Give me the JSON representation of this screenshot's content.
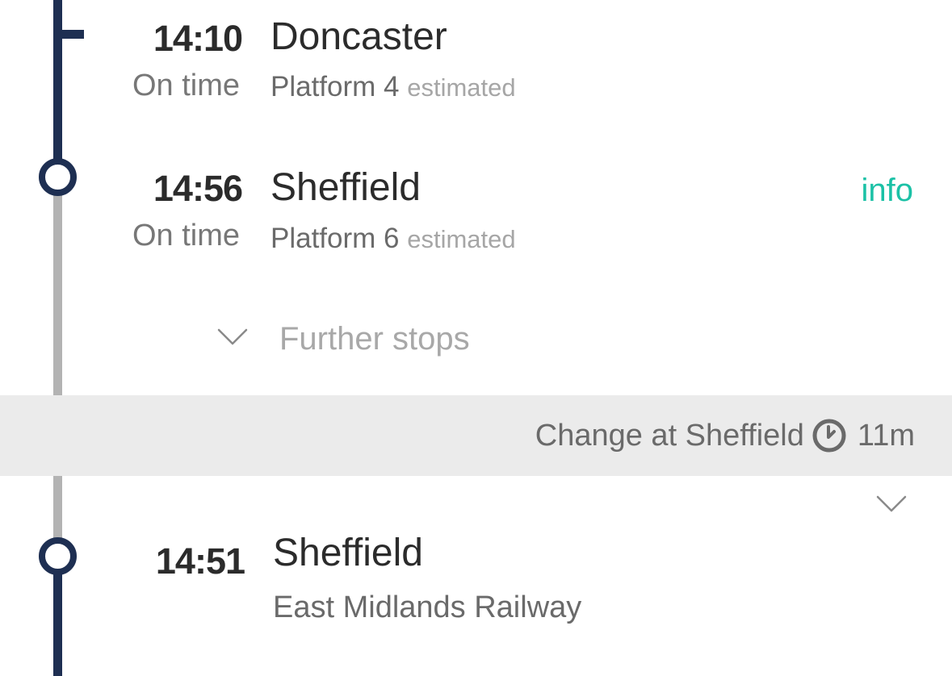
{
  "stops": [
    {
      "time": "14:10",
      "status": "On time",
      "station": "Doncaster",
      "platform": "Platform 4",
      "platform_note": "estimated"
    },
    {
      "time": "14:56",
      "status": "On time",
      "station": "Sheffield",
      "platform": "Platform 6",
      "platform_note": "estimated",
      "info_label": "info"
    }
  ],
  "further_stops_label": "Further stops",
  "change": {
    "label": "Change at Sheffield",
    "duration": "11m",
    "icon": "clock-icon"
  },
  "next_leg": {
    "time": "14:51",
    "station": "Sheffield",
    "operator": "East Midlands Railway"
  },
  "icons": {
    "further_stops": "chevron-down-icon",
    "expand_leg": "chevron-down-icon"
  },
  "colors": {
    "route_line": "#1e2f52",
    "route_line_muted": "#b3b3b3",
    "accent": "#1bc1a6",
    "change_band": "#ebebeb"
  }
}
